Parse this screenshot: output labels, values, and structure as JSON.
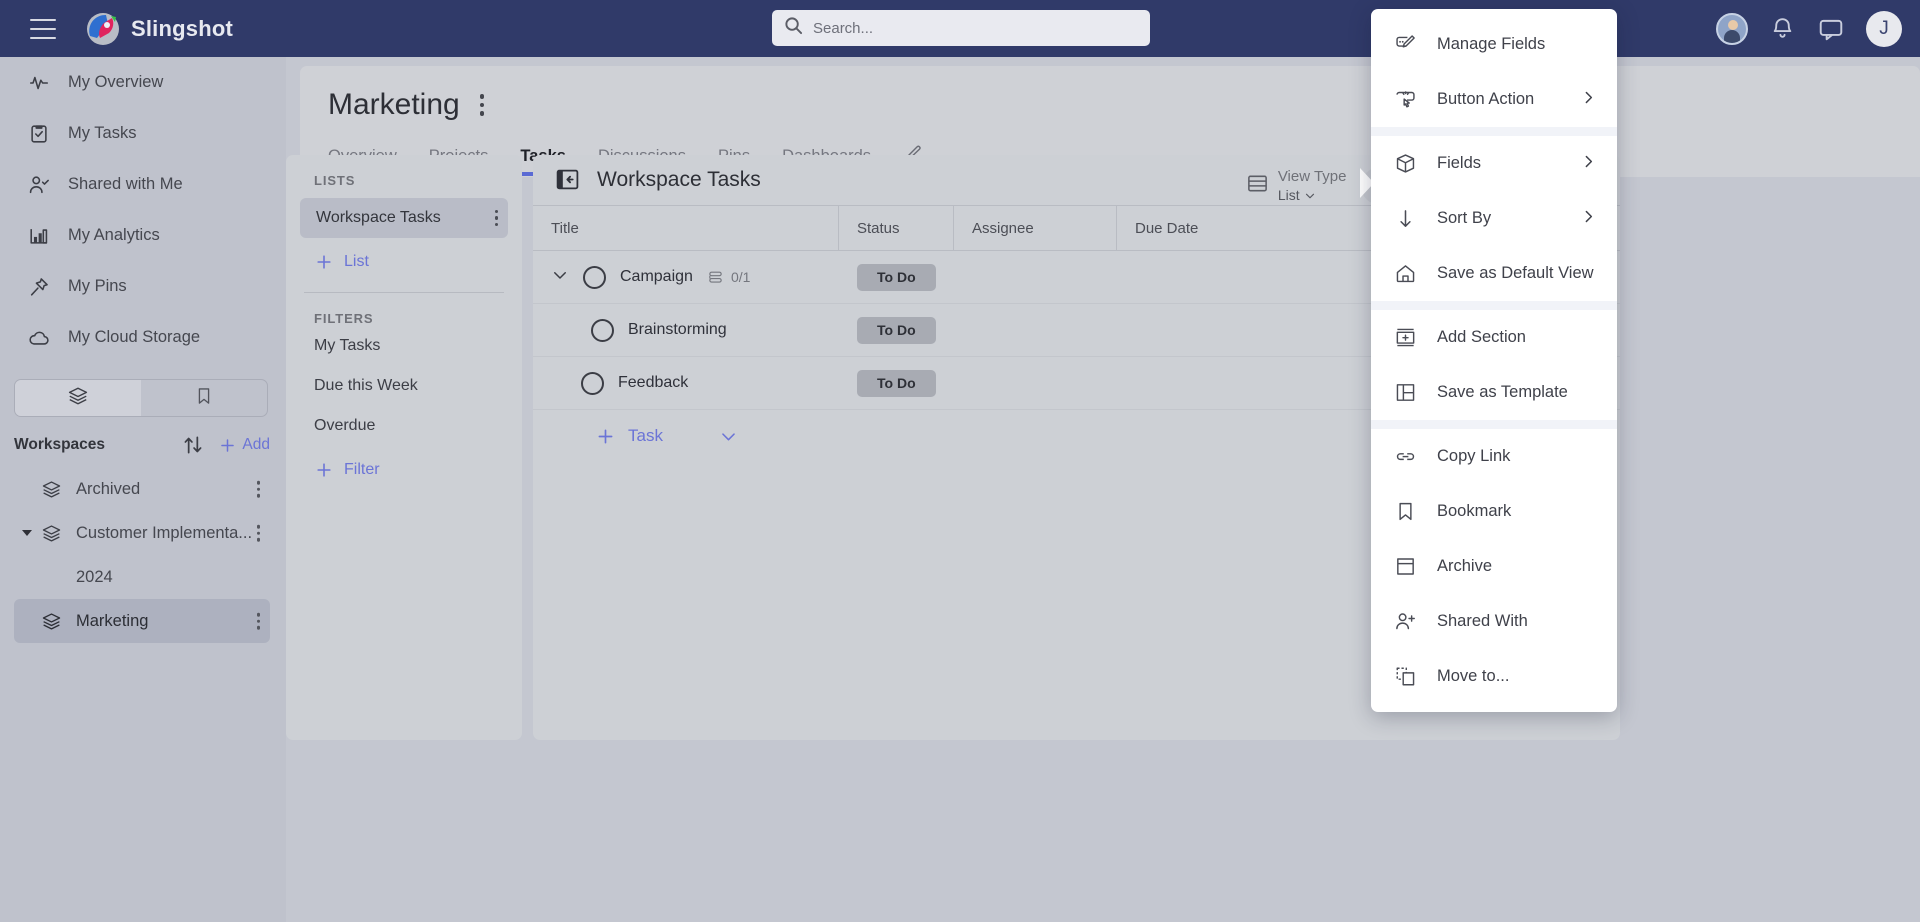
{
  "topbar": {
    "brand": "Slingshot",
    "menu_icon": "hamburger-icon",
    "search_placeholder": "Search...",
    "search_value": "",
    "avatar_letter": "J"
  },
  "sidebar": {
    "nav_items": [
      {
        "label": "My Overview",
        "icon": "activity-icon"
      },
      {
        "label": "My Tasks",
        "icon": "clipboard-check-icon"
      },
      {
        "label": "Shared with Me",
        "icon": "user-check-icon"
      },
      {
        "label": "My Analytics",
        "icon": "bar-chart-icon"
      },
      {
        "label": "My Pins",
        "icon": "pin-icon"
      },
      {
        "label": "My Cloud Storage",
        "icon": "cloud-icon"
      }
    ],
    "segments": [
      {
        "icon": "layers-icon",
        "active": true
      },
      {
        "icon": "bookmark-icon",
        "active": false
      }
    ],
    "workspaces_title": "Workspaces",
    "sort_icon": "sort-arrows-icon",
    "add_label": "Add",
    "workspaces": [
      {
        "label": "Archived",
        "expandable": false,
        "selected": false
      },
      {
        "label": "Customer Implementa...",
        "expandable": true,
        "selected": false
      },
      {
        "label": "2024",
        "child": true,
        "selected": false
      },
      {
        "label": "Marketing",
        "expandable": false,
        "selected": true
      }
    ]
  },
  "page": {
    "title": "Marketing",
    "tabs": [
      {
        "label": "Overview",
        "active": false
      },
      {
        "label": "Projects",
        "active": false
      },
      {
        "label": "Tasks",
        "active": true
      },
      {
        "label": "Discussions",
        "active": false
      },
      {
        "label": "Pins",
        "active": false
      },
      {
        "label": "Dashboards",
        "active": false
      }
    ],
    "edit_icon": "pencil-icon"
  },
  "lists_panel": {
    "lists_label": "LISTS",
    "lists": [
      {
        "label": "Workspace Tasks",
        "selected": true
      }
    ],
    "add_list_label": "List",
    "filters_label": "FILTERS",
    "filters": [
      {
        "label": "My Tasks"
      },
      {
        "label": "Due this Week"
      },
      {
        "label": "Overdue"
      }
    ],
    "add_filter_label": "Filter"
  },
  "task_panel": {
    "title": "Workspace Tasks",
    "collapse_icon": "panel-collapse-icon",
    "view_type_label": "View Type",
    "view_type_value": "List",
    "add_task_label": "Task",
    "filter_icon": "funnel-icon",
    "columns": [
      "Title",
      "Status",
      "Assignee",
      "Due Date"
    ],
    "rows": [
      {
        "title": "Campaign",
        "status": "To Do",
        "assignee": "",
        "due_date": "",
        "indent": 0,
        "has_children": true,
        "subcount": "0/1"
      },
      {
        "title": "Brainstorming",
        "status": "To Do",
        "assignee": "",
        "due_date": "",
        "indent": 1,
        "has_children": false,
        "subcount": ""
      },
      {
        "title": "Feedback",
        "status": "To Do",
        "assignee": "",
        "due_date": "",
        "indent": 0,
        "has_children": false,
        "subcount": ""
      }
    ],
    "add_row_label": "Task"
  },
  "context_menu": {
    "items": [
      {
        "label": "Manage Fields",
        "icon": "manage-fields-icon",
        "submenu": false
      },
      {
        "label": "Button Action",
        "icon": "button-action-icon",
        "submenu": true
      },
      {
        "separator_after": true
      },
      {
        "label": "Fields",
        "icon": "box-icon",
        "submenu": true
      },
      {
        "label": "Sort By",
        "icon": "arrow-down-icon",
        "submenu": true
      },
      {
        "label": "Save as Default View",
        "icon": "home-icon",
        "submenu": false
      },
      {
        "separator_after": true
      },
      {
        "label": "Add Section",
        "icon": "add-section-icon",
        "submenu": false
      },
      {
        "label": "Save as Template",
        "icon": "template-icon",
        "submenu": false
      },
      {
        "separator_after": true
      },
      {
        "label": "Copy Link",
        "icon": "link-icon",
        "submenu": false
      },
      {
        "label": "Bookmark",
        "icon": "bookmark-icon",
        "submenu": false
      },
      {
        "label": "Archive",
        "icon": "archive-icon",
        "submenu": false
      },
      {
        "label": "Shared With",
        "icon": "user-plus-icon",
        "submenu": false
      },
      {
        "label": "Move to...",
        "icon": "move-to-icon",
        "submenu": false
      }
    ]
  },
  "colors": {
    "topbar": "#303a69",
    "sidebar": "#bfc2cc",
    "accent": "#6271d6",
    "panel": "#cdd0d5",
    "badge": "#a8abb3"
  }
}
